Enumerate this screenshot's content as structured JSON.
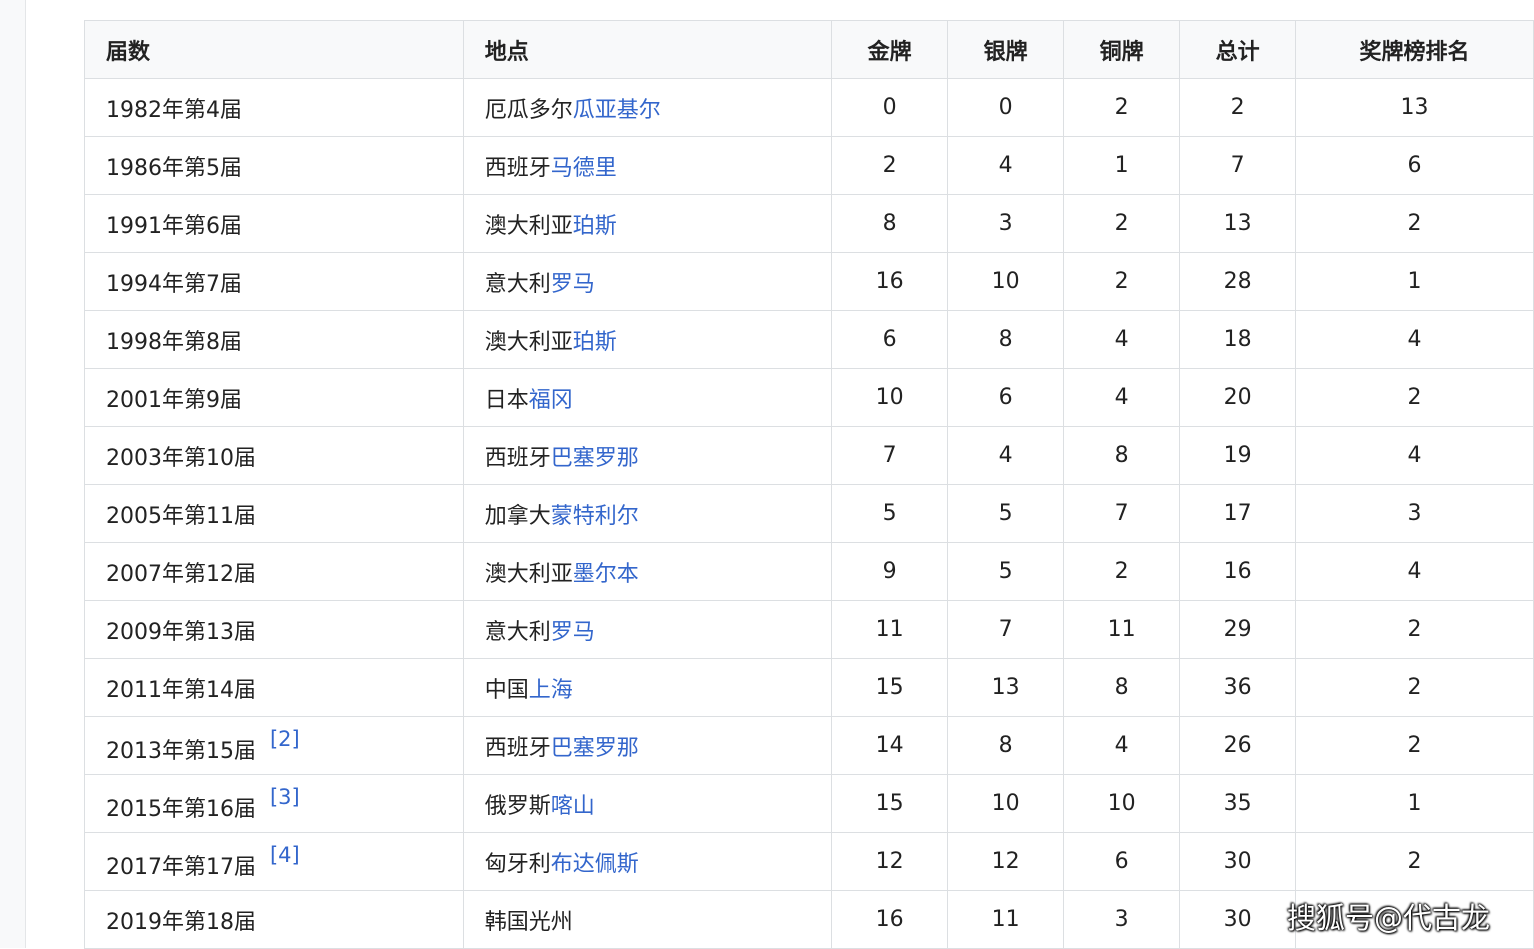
{
  "table": {
    "headers": [
      "届数",
      "地点",
      "金牌",
      "银牌",
      "铜牌",
      "总计",
      "奖牌榜排名"
    ],
    "rows": [
      {
        "edition": "1982年第4届",
        "ref": "",
        "country": "厄瓜多尔",
        "city": "瓜亚基尔",
        "gold": "0",
        "silver": "0",
        "bronze": "2",
        "total": "2",
        "rank": "13"
      },
      {
        "edition": "1986年第5届",
        "ref": "",
        "country": "西班牙",
        "city": "马德里",
        "gold": "2",
        "silver": "4",
        "bronze": "1",
        "total": "7",
        "rank": "6"
      },
      {
        "edition": "1991年第6届",
        "ref": "",
        "country": "澳大利亚",
        "city": "珀斯",
        "gold": "8",
        "silver": "3",
        "bronze": "2",
        "total": "13",
        "rank": "2"
      },
      {
        "edition": "1994年第7届",
        "ref": "",
        "country": "意大利",
        "city": "罗马",
        "gold": "16",
        "silver": "10",
        "bronze": "2",
        "total": "28",
        "rank": "1"
      },
      {
        "edition": "1998年第8届",
        "ref": "",
        "country": "澳大利亚",
        "city": "珀斯",
        "gold": "6",
        "silver": "8",
        "bronze": "4",
        "total": "18",
        "rank": "4"
      },
      {
        "edition": "2001年第9届",
        "ref": "",
        "country": "日本",
        "city": "福冈",
        "gold": "10",
        "silver": "6",
        "bronze": "4",
        "total": "20",
        "rank": "2"
      },
      {
        "edition": "2003年第10届",
        "ref": "",
        "country": "西班牙",
        "city": "巴塞罗那",
        "gold": "7",
        "silver": "4",
        "bronze": "8",
        "total": "19",
        "rank": "4"
      },
      {
        "edition": "2005年第11届",
        "ref": "",
        "country": "加拿大",
        "city": "蒙特利尔",
        "gold": "5",
        "silver": "5",
        "bronze": "7",
        "total": "17",
        "rank": "3"
      },
      {
        "edition": "2007年第12届",
        "ref": "",
        "country": "澳大利亚",
        "city": "墨尔本",
        "gold": "9",
        "silver": "5",
        "bronze": "2",
        "total": "16",
        "rank": "4"
      },
      {
        "edition": "2009年第13届",
        "ref": "",
        "country": "意大利",
        "city": "罗马",
        "gold": "11",
        "silver": "7",
        "bronze": "11",
        "total": "29",
        "rank": "2"
      },
      {
        "edition": "2011年第14届",
        "ref": "",
        "country": "中国",
        "city": "上海",
        "gold": "15",
        "silver": "13",
        "bronze": "8",
        "total": "36",
        "rank": "2"
      },
      {
        "edition": "2013年第15届",
        "ref": "[2]",
        "country": "西班牙",
        "city": "巴塞罗那",
        "gold": "14",
        "silver": "8",
        "bronze": "4",
        "total": "26",
        "rank": "2"
      },
      {
        "edition": "2015年第16届",
        "ref": "[3]",
        "country": "俄罗斯",
        "city": "喀山",
        "gold": "15",
        "silver": "10",
        "bronze": "10",
        "total": "35",
        "rank": "1"
      },
      {
        "edition": "2017年第17届",
        "ref": "[4]",
        "country": "匈牙利",
        "city": "布达佩斯",
        "gold": "12",
        "silver": "12",
        "bronze": "6",
        "total": "30",
        "rank": "2"
      },
      {
        "edition": "2019年第18届",
        "ref": "",
        "country": "韩国光州",
        "city": "",
        "gold": "16",
        "silver": "11",
        "bronze": "3",
        "total": "30",
        "rank": ""
      }
    ]
  },
  "watermark": "搜狐号@代古龙",
  "colors": {
    "link": "#3366cc",
    "header_bg": "#f8f9fa",
    "border": "#dcdfe2",
    "text": "#222222"
  }
}
